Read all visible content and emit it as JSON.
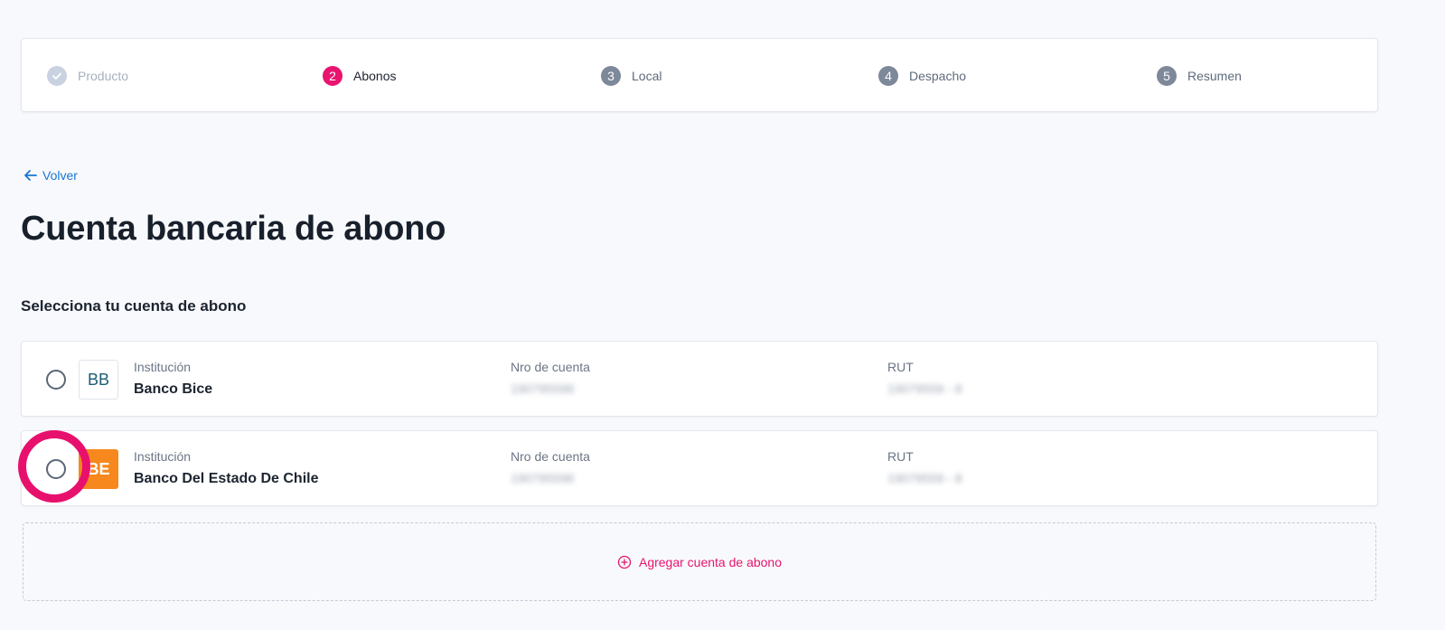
{
  "stepper": {
    "steps": [
      {
        "number": "✓",
        "label": "Producto",
        "state": "done"
      },
      {
        "number": "2",
        "label": "Abonos",
        "state": "active"
      },
      {
        "number": "3",
        "label": "Local",
        "state": "todo"
      },
      {
        "number": "4",
        "label": "Despacho",
        "state": "todo"
      },
      {
        "number": "5",
        "label": "Resumen",
        "state": "todo"
      }
    ]
  },
  "back": {
    "label": "Volver"
  },
  "page": {
    "title": "Cuenta bancaria de abono",
    "subtitle": "Selecciona tu cuenta de abono"
  },
  "accounts": [
    {
      "logo_text": "BB",
      "institution_label": "Institución",
      "institution": "Banco Bice",
      "account_label": "Nro de cuenta",
      "account_number": "190795598",
      "rut_label": "RUT",
      "rut": "19079559 - 8"
    },
    {
      "logo_text": "BE",
      "institution_label": "Institución",
      "institution": "Banco Del Estado De Chile",
      "account_label": "Nro de cuenta",
      "account_number": "190795598",
      "rut_label": "RUT",
      "rut": "19079559 - 8"
    }
  ],
  "add_account": {
    "label": "Agregar cuenta de abono"
  },
  "colors": {
    "accent": "#e8146f",
    "link": "#1876d2",
    "estado_orange": "#f7881d",
    "background": "#f8f9fc"
  },
  "icons": {
    "back": "arrow-left-icon",
    "add": "plus-circle-icon",
    "done": "check-icon"
  }
}
